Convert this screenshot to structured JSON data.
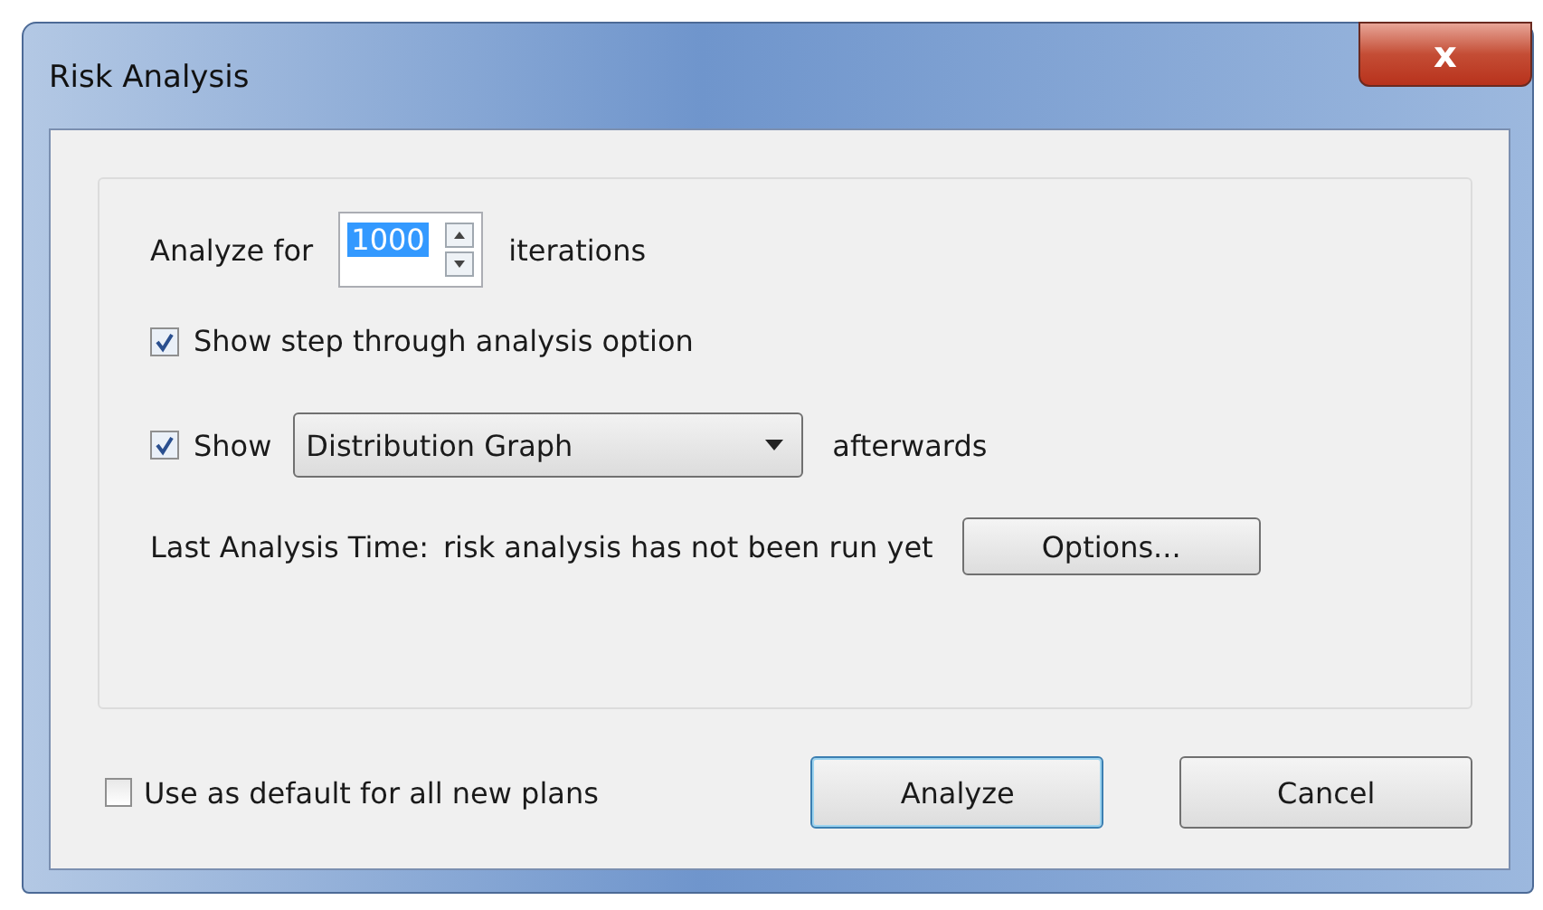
{
  "window": {
    "title": "Risk Analysis",
    "close_label": "x"
  },
  "iterations": {
    "label": "Analyze for",
    "value": "1000",
    "unit": "iterations"
  },
  "step_through": {
    "label": "Show step through analysis option",
    "checked": true
  },
  "show_after": {
    "label": "Show",
    "checked": true,
    "dropdown": "Distribution Graph",
    "suffix": "afterwards"
  },
  "last_analysis": {
    "label": "Last Analysis Time:",
    "value": "risk analysis has not been run yet"
  },
  "options_button": "Options...",
  "default_checkbox": {
    "label": "Use as default for all new plans",
    "checked": false
  },
  "buttons": [
    {
      "label": "Analyze",
      "selected": true
    },
    {
      "label": "Cancel",
      "selected": false
    }
  ]
}
